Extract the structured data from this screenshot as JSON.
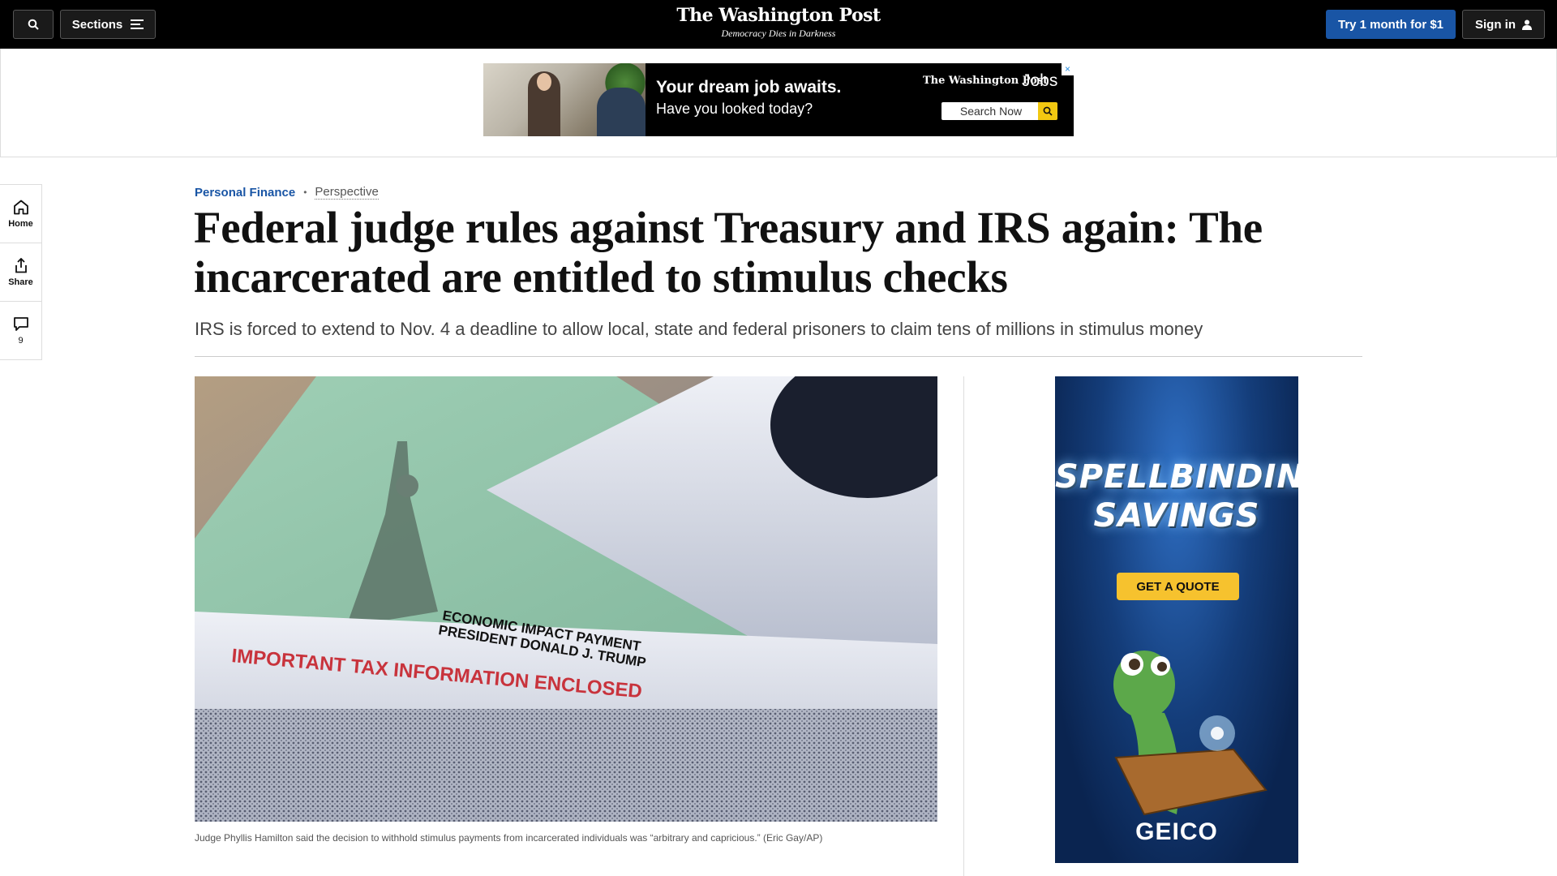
{
  "nav": {
    "sections_label": "Sections",
    "brand_title": "The Washington Post",
    "brand_tagline": "Democracy Dies in Darkness",
    "subscribe_label": "Try 1 month for $1",
    "signin_label": "Sign in"
  },
  "top_ad": {
    "headline": "Your dream job awaits.",
    "subline": "Have you looked today?",
    "brand": "The Washington Post",
    "brand_suffix": "Jobs",
    "search_label": "Search Now"
  },
  "rail": {
    "home_label": "Home",
    "share_label": "Share",
    "comments_count": "9"
  },
  "article": {
    "section": "Personal Finance",
    "label": "Perspective",
    "headline": "Federal judge rules against Treasury and IRS again: The incarcerated are entitled to stimulus checks",
    "dek": "IRS is forced to extend to Nov. 4 a deadline to allow local, state and federal prisoners to claim tens of millions in stimulus money",
    "image": {
      "text_line1": "ECONOMIC IMPACT PAYMENT",
      "text_line2": "PRESIDENT DONALD J. TRUMP",
      "envelope_text": "IMPORTANT TAX INFORMATION ENCLOSED"
    },
    "caption": "Judge Phyllis Hamilton said the decision to withhold stimulus payments from incarcerated individuals was “arbitrary and capricious.” (Eric Gay/AP)"
  },
  "side_ad": {
    "title_line1": "SPELLBINDING",
    "title_line2": "SAVINGS",
    "cta": "GET A QUOTE",
    "logo": "GEICO"
  },
  "colors": {
    "accent": "#1955a5",
    "topbar": "#000000",
    "cta_yellow": "#f6c22e"
  }
}
